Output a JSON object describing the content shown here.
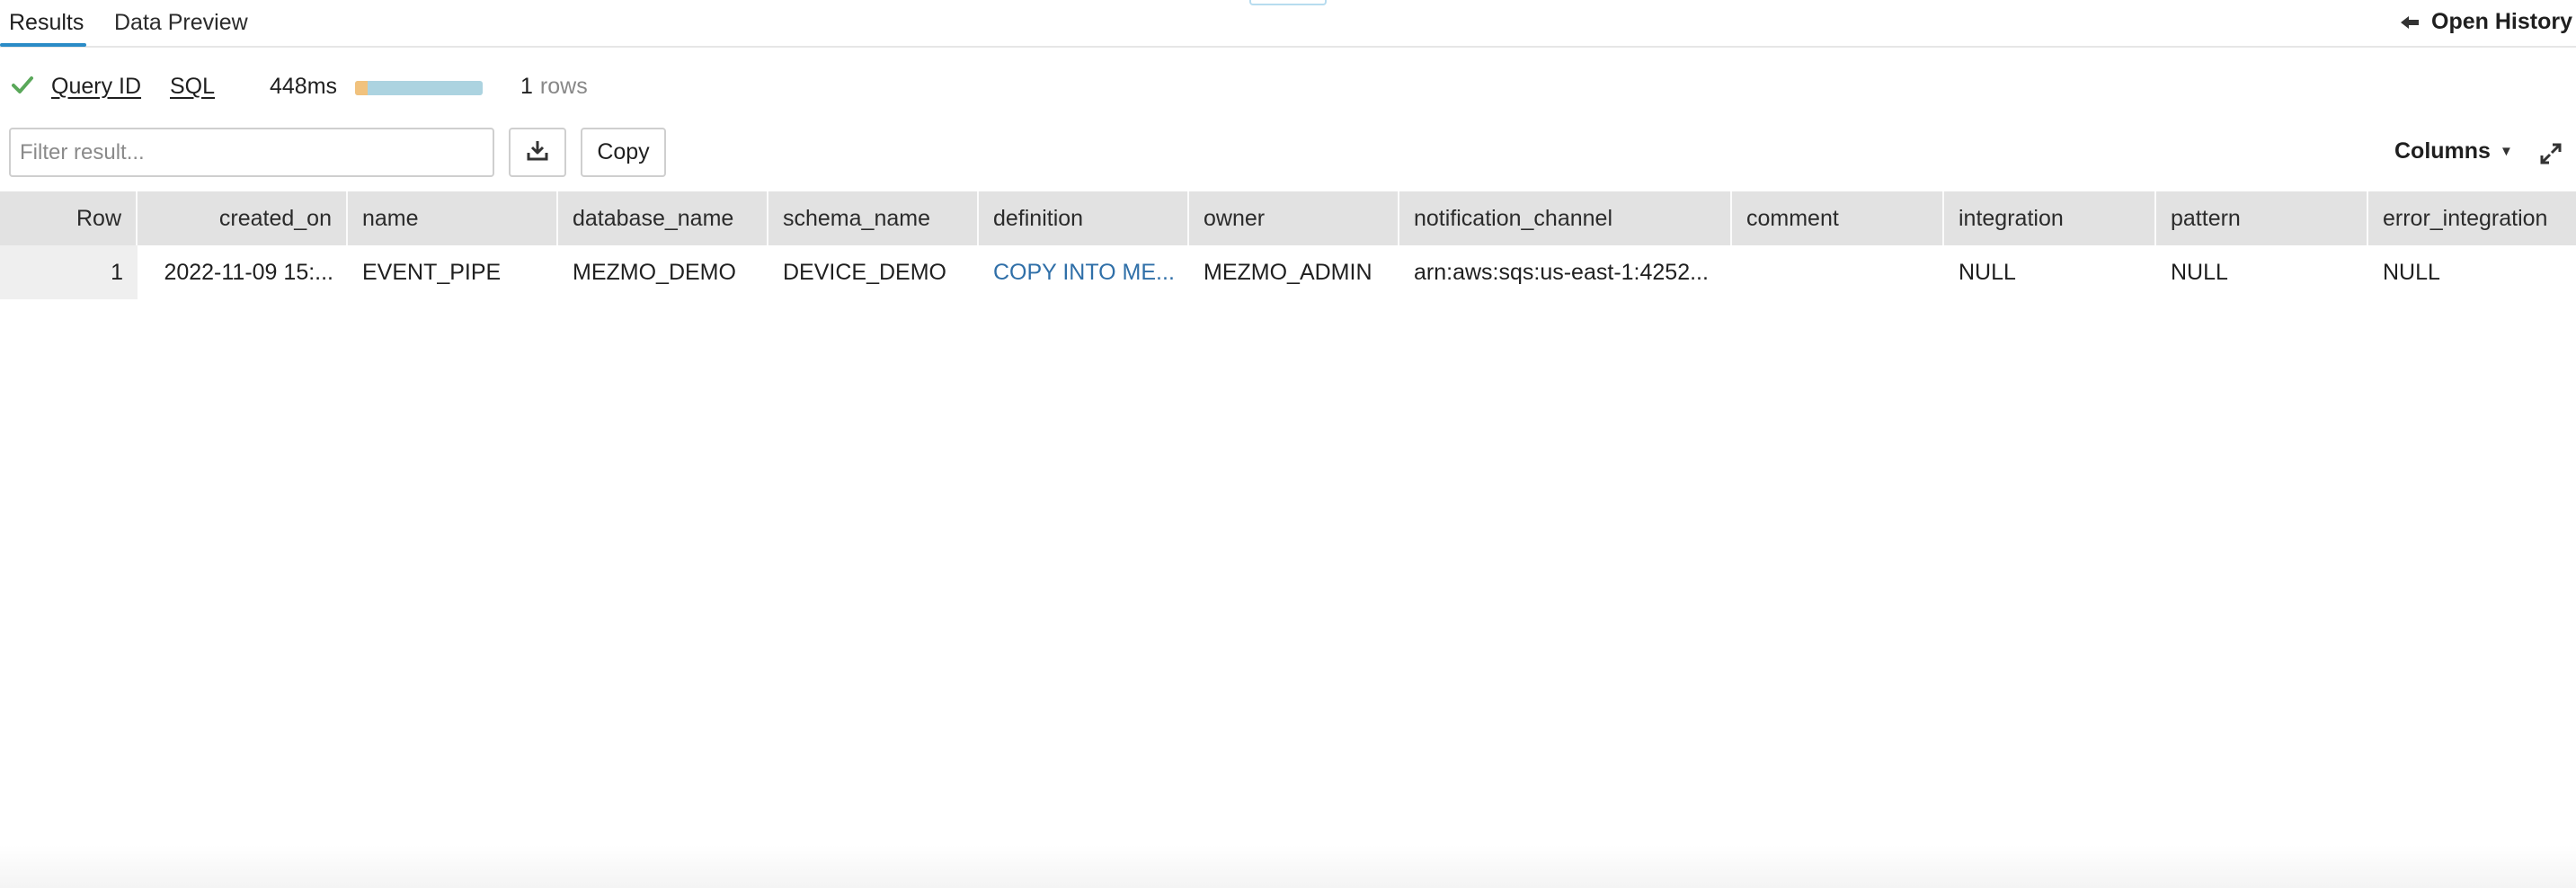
{
  "tabs": [
    {
      "label": "Results",
      "active": true
    },
    {
      "label": "Data Preview",
      "active": false
    }
  ],
  "history": {
    "label": "Open History",
    "icon": "arrow-left-icon"
  },
  "query_info": {
    "status_icon": "check-icon",
    "status_color": "#5aa85a",
    "query_id_label": "Query ID",
    "sql_label": "SQL",
    "duration": "448ms",
    "rows_count": "1",
    "rows_unit": "rows"
  },
  "toolbar": {
    "filter_placeholder": "Filter result...",
    "download_icon": "download-icon",
    "copy_label": "Copy",
    "columns_label": "Columns",
    "expand_icon": "expand-icon"
  },
  "table": {
    "columns": [
      "Row",
      "created_on",
      "name",
      "database_name",
      "schema_name",
      "definition",
      "owner",
      "notification_channel",
      "comment",
      "integration",
      "pattern",
      "error_integration"
    ],
    "rows": [
      [
        "1",
        "2022-11-09 15:...",
        "EVENT_PIPE",
        "MEZMO_DEMO",
        "DEVICE_DEMO",
        "COPY INTO ME...",
        "MEZMO_ADMIN",
        "arn:aws:sqs:us-east-1:4252...",
        "",
        "NULL",
        "NULL",
        "NULL"
      ]
    ]
  },
  "colors": {
    "accent": "#2a8bc6",
    "link": "#2f6fa8",
    "header_bg": "#e2e2e2"
  }
}
